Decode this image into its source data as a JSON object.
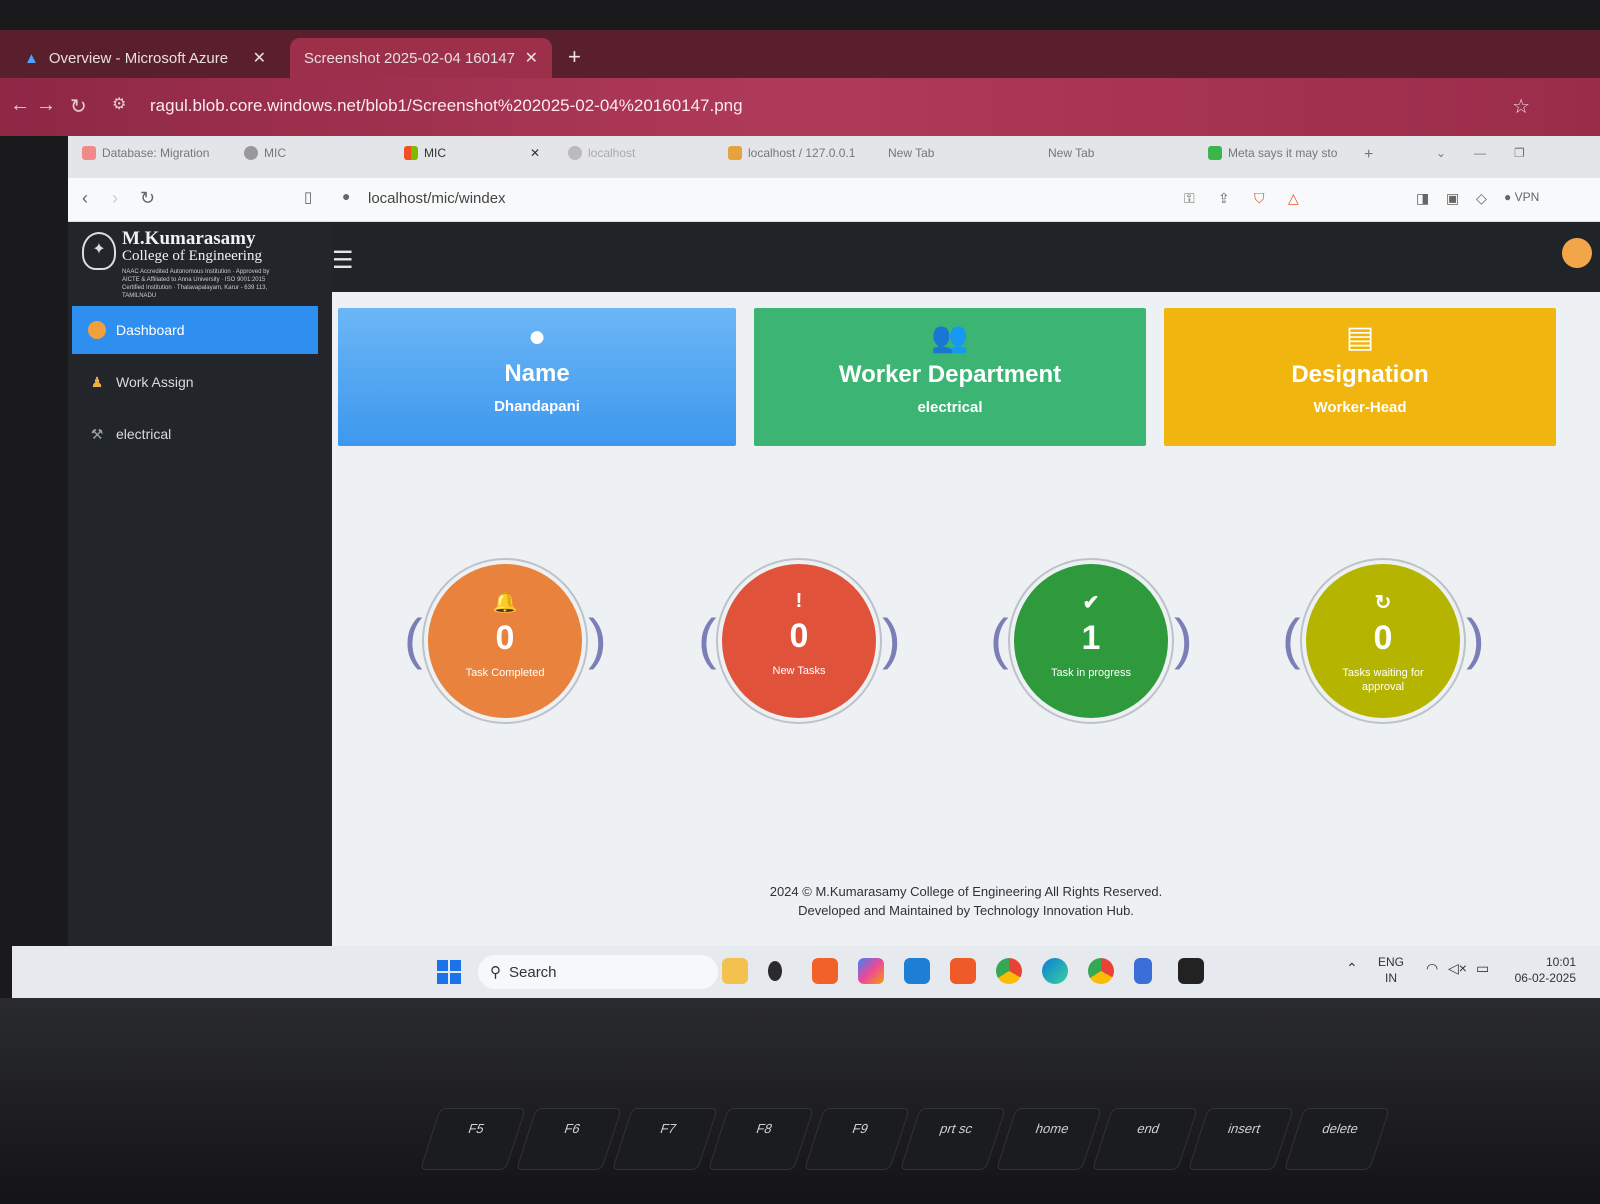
{
  "outer_browser": {
    "tabs": [
      {
        "label": "Overview - Microsoft Azure",
        "active": false
      },
      {
        "label": "Screenshot 2025-02-04 160147",
        "active": true
      }
    ],
    "url": "ragul.blob.core.windows.net/blob1/Screenshot%202025-02-04%20160147.png"
  },
  "inner_browser": {
    "tabs": [
      {
        "label": "Database: Migration"
      },
      {
        "label": "MIC"
      },
      {
        "label": "MIC"
      },
      {
        "label": "localhost"
      },
      {
        "label": "localhost / 127.0.0.1"
      },
      {
        "label": "New Tab"
      },
      {
        "label": "New Tab"
      },
      {
        "label": "Meta says it may sto"
      }
    ],
    "url": "localhost/mic/windex",
    "vpn_label": "VPN"
  },
  "brand": {
    "name": "M.Kumarasamy",
    "sub": "College of Engineering",
    "fine": "NAAC Accredited Autonomous Institution · Approved by AICTE & Affiliated to Anna University · ISO 9001:2015 Certified Institution · Thalavapalayam, Karur - 639 113, TAMILNADU"
  },
  "sidebar": {
    "items": [
      {
        "label": "Dashboard",
        "active": true
      },
      {
        "label": "Work Assign",
        "active": false
      },
      {
        "label": "electrical",
        "active": false
      }
    ]
  },
  "cards": [
    {
      "title": "Name",
      "value": "Dhandapani",
      "color": "#4aa3f0"
    },
    {
      "title": "Worker Department",
      "value": "electrical",
      "color": "#3cb574"
    },
    {
      "title": "Designation",
      "value": "Worker-Head",
      "color": "#f1b510"
    }
  ],
  "stats": [
    {
      "value": "0",
      "label": "Task Completed",
      "color": "#e8823c",
      "icon": "bell-icon"
    },
    {
      "value": "0",
      "label": "New Tasks",
      "color": "#e0533a",
      "icon": "exclamation-icon"
    },
    {
      "value": "1",
      "label": "Task in progress",
      "color": "#2e9a3c",
      "icon": "check-icon"
    },
    {
      "value": "0",
      "label": "Tasks waiting for approval",
      "color": "#b5b400",
      "icon": "refresh-icon"
    }
  ],
  "footer": {
    "line1": "2024 © M.Kumarasamy College of Engineering All Rights Reserved.",
    "line2": "Developed and Maintained by Technology Innovation Hub."
  },
  "taskbar": {
    "search_placeholder": "Search",
    "lang1": "ENG",
    "lang2": "IN",
    "time": "10:01",
    "date": "06-02-2025"
  },
  "keyboard": {
    "keys": [
      "F5",
      "F6",
      "F7",
      "F8",
      "F9",
      "prt sc",
      "home",
      "end",
      "insert",
      "delete"
    ]
  }
}
